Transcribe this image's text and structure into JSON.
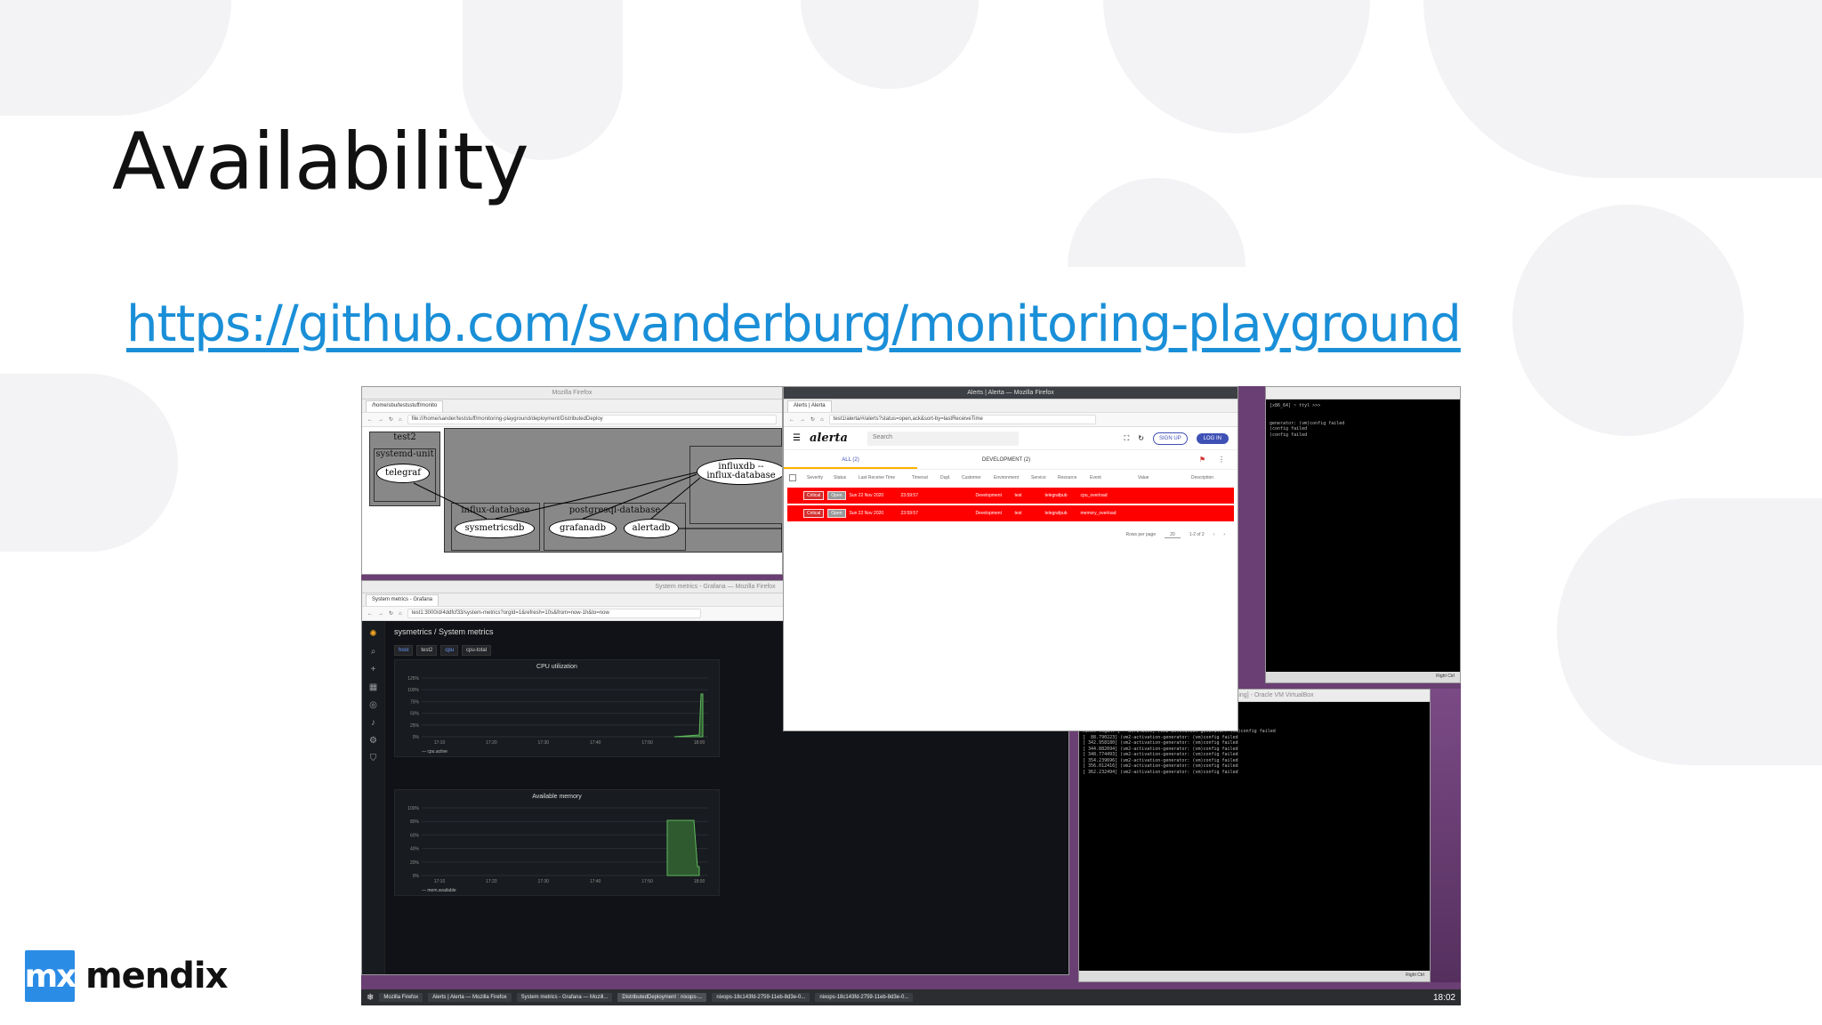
{
  "slide": {
    "title": "Availability",
    "link": "https://github.com/svanderburg/monitoring-playground",
    "logo_mark": "mx",
    "logo_word": "mendix"
  },
  "graph_window": {
    "title": "Mozilla Firefox",
    "tab": "/home/sbu/testsstuff/monito",
    "url": "file:///home/sander/teststuff/monitoring-playground/deployment/DistributedDeploy",
    "clusters": {
      "test2": "test2",
      "systemd_unit": "systemd-unit",
      "influx_database": "influx-database",
      "postgresql_database": "postgresql-database"
    },
    "nodes": {
      "telegraf": "telegraf",
      "influxdb": "influxdb --\ninflux-database",
      "sysmetricsdb": "sysmetricsdb",
      "grafanadb": "grafanadb",
      "alertadb": "alertadb"
    }
  },
  "grafana_window": {
    "title": "System metrics - Grafana — Mozilla Firefox",
    "tab": "System metrics - Grafana",
    "url": "test1:3000/d/4ddfcf33/system-metrics?orgId=1&refresh=10s&from=now-1h&to=now",
    "breadcrumb": "sysmetrics / System metrics",
    "vars": {
      "host_label": "host",
      "host_value": "test2",
      "cpu_label": "cpu",
      "cpu_value": "cpu-total"
    },
    "cpu_panel": {
      "title": "CPU utilization",
      "yticks": [
        "125%",
        "100%",
        "75%",
        "50%",
        "25%",
        "0%"
      ],
      "xticks": [
        "17:10",
        "17:20",
        "17:30",
        "17:40",
        "17:50",
        "18:00"
      ],
      "legend": "cpu.active"
    },
    "mem_panel": {
      "title": "Available memory",
      "yticks": [
        "100%",
        "80%",
        "60%",
        "40%",
        "20%",
        "0%"
      ],
      "xticks": [
        "17:10",
        "17:20",
        "17:30",
        "17:40",
        "17:50",
        "18:00"
      ],
      "legend": "mem.available"
    }
  },
  "alerta_window": {
    "title": "Alerts | Alerta — Mozilla Firefox",
    "tab": "Alerts | Alerta",
    "url": "test1/alerta/#/alerts?status=open,ack&sort-by=lastReceiveTime",
    "logo": "alerta",
    "search_placeholder": "Search",
    "sign_up": "SIGN UP",
    "log_in": "LOG IN",
    "tab_all": "ALL (2)",
    "tab_dev": "DEVELOPMENT (2)",
    "columns": [
      "Severity",
      "Status",
      "Last Receive Time",
      "Timeout",
      "Dupl.",
      "Customer",
      "Environment",
      "Service",
      "Resource",
      "Event",
      "Value",
      "Description"
    ],
    "rows": [
      {
        "severity": "Critical",
        "status": "Open",
        "time": "Sun 22 Nov 2020",
        "timeout": "23:59:57",
        "environment": "Development",
        "service": "test",
        "resource": "telegrafpub",
        "event": "cpu_overload"
      },
      {
        "severity": "Critical",
        "status": "Open",
        "time": "Sun 22 Nov 2020",
        "timeout": "23:59:57",
        "environment": "Development",
        "service": "test",
        "resource": "telegrafpub",
        "event": "memory_overload"
      }
    ],
    "rows_per_page_label": "Rows per page",
    "rows_per_page": "20",
    "range": "1-2 of 2"
  },
  "terminal_top": {
    "lines": [
      "[x86_64] ~ ttyl >>>",
      "",
      "",
      "generator: (vm)config failed",
      "(config failed",
      "(config failed"
    ],
    "status": "Right Ctrl"
  },
  "terminal_bottom": {
    "title": "nixops-... [Running] - Oracle VM VirtualBox",
    "lines": [
      "<<< Welcome to NixOS ... (x86_64) - ttyl >>>",
      "",
      "Run 'nixos-help' for the NixOS manual.",
      "",
      "nixos login: [   86.143609] (vm2-activation-generator: (vm)config failed",
      "[  88.790223] (vm2-activation-generator: (vm)config failed",
      "[ 342.958180] (vm2-activation-generator: (vm)config failed",
      "[ 344.882694] (vm2-activation-generator: (vm)config failed",
      "[ 348.774493] (vm2-activation-generator: (vm)config failed",
      "[ 354.239696] (vm2-activation-generator: (vm)config failed",
      "[ 356.012416] (vm2-activation-generator: (vm)config failed",
      "[ 362.232494] (vm2-activation-generator: (vm)config failed"
    ],
    "status": "Right Ctrl"
  },
  "taskbar": {
    "items": [
      "Mozilla Firefox",
      "Alerts | Alerta — Mozilla Firefox",
      "System metrics - Grafana — Mozill...",
      "DistributedDeployment : nixops-...",
      "nixops-18c143fd-2759-11eb-8d3e-0...",
      "nixops-18c143fd-2759-11eb-8d3e-0..."
    ],
    "clock": "18:02"
  }
}
